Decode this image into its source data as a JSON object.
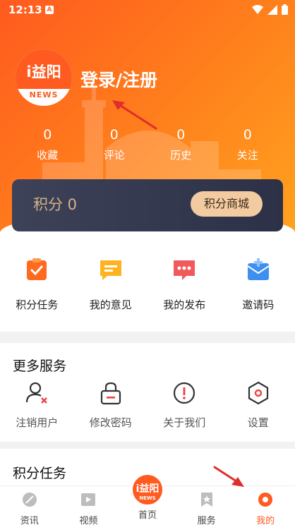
{
  "status_bar": {
    "time": "12:13",
    "sim_label": "A"
  },
  "profile": {
    "logo_text": "i益阳",
    "logo_sub": "NEWS",
    "login_label": "登录/注册"
  },
  "stats": [
    {
      "count": "0",
      "label": "收藏"
    },
    {
      "count": "0",
      "label": "评论"
    },
    {
      "count": "0",
      "label": "历史"
    },
    {
      "count": "0",
      "label": "关注"
    }
  ],
  "points": {
    "label": "积分 0",
    "mall_button": "积分商城"
  },
  "quick_actions": [
    {
      "label": "积分任务",
      "icon": "task-icon"
    },
    {
      "label": "我的意见",
      "icon": "feedback-icon"
    },
    {
      "label": "我的发布",
      "icon": "publish-icon"
    },
    {
      "label": "邀请码",
      "icon": "invite-icon"
    }
  ],
  "more_services": {
    "title": "更多服务",
    "items": [
      {
        "label": "注销用户",
        "icon": "user-remove-icon"
      },
      {
        "label": "修改密码",
        "icon": "lock-icon"
      },
      {
        "label": "关于我们",
        "icon": "info-icon"
      },
      {
        "label": "设置",
        "icon": "gear-icon"
      }
    ]
  },
  "points_tasks": {
    "title": "积分任务"
  },
  "tabbar": {
    "tabs": [
      {
        "label": "资讯",
        "icon": "news-icon"
      },
      {
        "label": "视频",
        "icon": "video-icon"
      },
      {
        "label": "首页",
        "icon": "home-logo-icon",
        "badge_text": "i益阳",
        "badge_sub": "NEWS"
      },
      {
        "label": "服务",
        "icon": "service-icon"
      },
      {
        "label": "我的",
        "icon": "profile-icon"
      }
    ],
    "active_tab": "我的"
  },
  "colors": {
    "accent": "#ff5a1f",
    "card_dark": "#353a50",
    "gold": "#f2cba0"
  }
}
